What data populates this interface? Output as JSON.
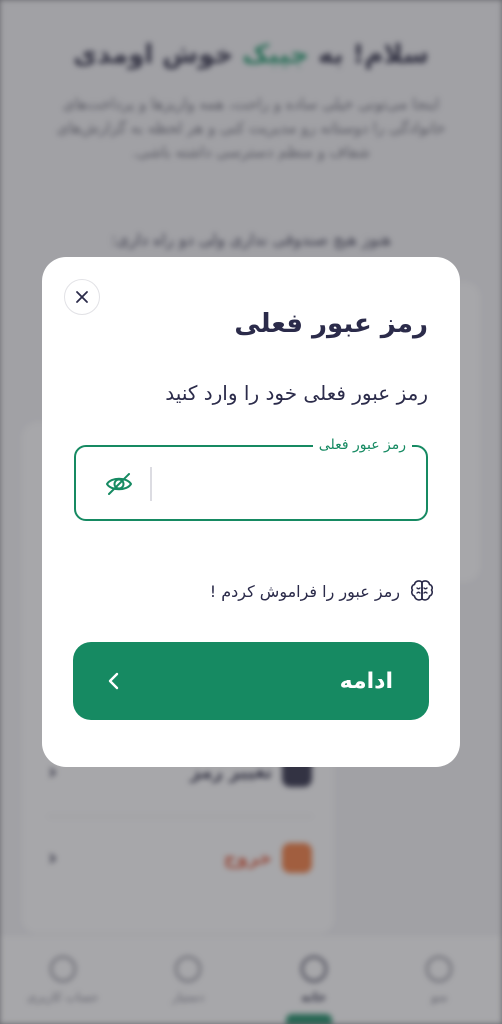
{
  "background": {
    "title_part1": "سلام! به",
    "title_brand": "جیبک",
    "title_part2": "خوش اومدی",
    "description": "اینجا می‌تونی خیلی ساده و راحت، همه واریزها و پرداخت‌های خانوادگی را دوستانه رو مدیریت کنی و هر لحظه به گزارش‌های شفاف و منظم دسترسی داشته باشی.",
    "empty_text": "هنوز هیچ صندوقی نداری ولی دو راه داری:",
    "menu": {
      "change_password_label": "تغییر رمز",
      "exit_label": "خروج"
    },
    "nav": {
      "items": [
        {
          "label": "منو"
        },
        {
          "label": "خانه"
        },
        {
          "label": "دستیار"
        },
        {
          "label": "حساب کاربری"
        }
      ]
    }
  },
  "modal": {
    "title": "رمز عبور فعلی",
    "subtitle": "رمز عبور فعلی خود را وارد کنید",
    "field": {
      "label": "رمز عبور فعلی",
      "value": "",
      "placeholder": ""
    },
    "forgot_text": "رمز عبور را فراموش کردم !",
    "continue_label": "ادامه"
  },
  "colors": {
    "primary": "#168a62",
    "title": "#2b2b4a",
    "exit": "#e25a3a"
  },
  "icons": {
    "close": "close-icon",
    "eye": "eye-off-icon",
    "forgot": "brain-icon",
    "continue": "chevron-left-icon"
  }
}
